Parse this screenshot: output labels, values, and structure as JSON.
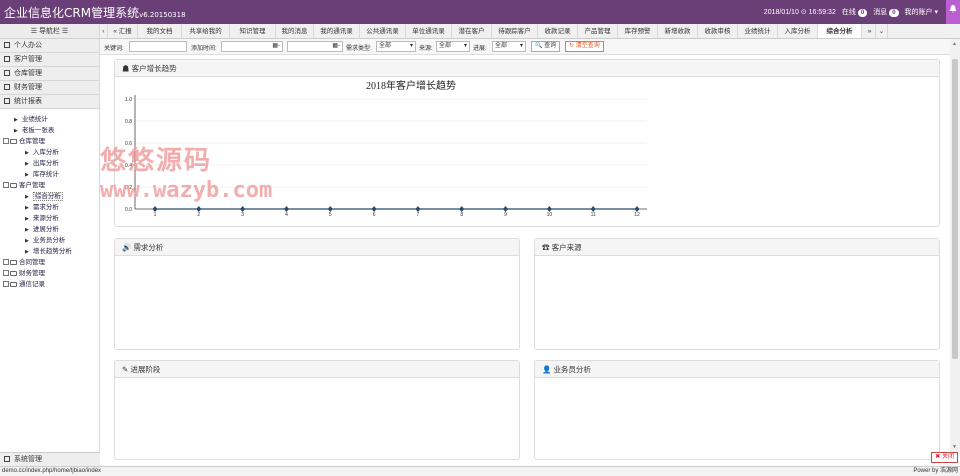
{
  "app": {
    "title": "企业信息化CRM管理系统",
    "version": "v6.20150318"
  },
  "header": {
    "datetime": "2018/01/10 ⊙ 16:59:32",
    "online_label": "在线",
    "online_count": "0",
    "msg_label": "消息",
    "msg_count": "0",
    "account": "我的账户 ▾"
  },
  "sidebar": {
    "nav_title": "☰ 导航栏 ☰",
    "menus": [
      "个人办公",
      "客户管理",
      "仓库管理",
      "财务管理",
      "统计报表"
    ],
    "system": "系统管理"
  },
  "tree": [
    {
      "label": "业绩统计",
      "level": 1,
      "type": "arrow"
    },
    {
      "label": "老板一张表",
      "level": 1,
      "type": "arrow"
    },
    {
      "label": "仓库管理",
      "level": 0,
      "type": "folder"
    },
    {
      "label": "入库分析",
      "level": 2,
      "type": "arrow"
    },
    {
      "label": "出库分析",
      "level": 2,
      "type": "arrow"
    },
    {
      "label": "库存统计",
      "level": 2,
      "type": "arrow"
    },
    {
      "label": "客户管理",
      "level": 0,
      "type": "folder"
    },
    {
      "label": "综合分析",
      "level": 2,
      "type": "arrow",
      "selected": true
    },
    {
      "label": "需求分析",
      "level": 2,
      "type": "arrow"
    },
    {
      "label": "来源分析",
      "level": 2,
      "type": "arrow"
    },
    {
      "label": "进展分析",
      "level": 2,
      "type": "arrow"
    },
    {
      "label": "业务员分析",
      "level": 2,
      "type": "arrow"
    },
    {
      "label": "增长趋势分析",
      "level": 2,
      "type": "arrow"
    },
    {
      "label": "合同管理",
      "level": 0,
      "type": "folder-closed"
    },
    {
      "label": "财务管理",
      "level": 0,
      "type": "folder-closed"
    },
    {
      "label": "通信记录",
      "level": 0,
      "type": "folder-closed"
    }
  ],
  "tabs": [
    "« 汇报",
    "我的文档",
    "共享给我的",
    "知识管理",
    "我的消息",
    "我的通讯录",
    "公共通讯录",
    "单位通讯录",
    "潜在客户",
    "待跟踪客户",
    "收款记录",
    "产品管理",
    "库存预警",
    "新增收款",
    "收款审核",
    "业绩统计",
    "入库分析",
    "综合分析"
  ],
  "tab_scroll": "»",
  "tab_menu": "⌄",
  "filter": {
    "keyword_label": "关键词:",
    "added_label": "添加时间:",
    "date_icon": "▦-",
    "demand_label": "需求类型:",
    "demand_value": "全部",
    "source_label": "来源:",
    "source_value": "全部",
    "progress_label": "进展:",
    "progress_value": "全部",
    "search_label": "🔍 查询",
    "clear_label": "↻ 清空查询"
  },
  "panels": {
    "growth": "客户增长趋势",
    "demand": "需求分析",
    "source": "客户来源",
    "progress": "进展阶段",
    "sales": "业务员分析"
  },
  "chart_data": {
    "type": "line",
    "title": "2018年客户增长趋势",
    "categories": [
      "1",
      "2",
      "3",
      "4",
      "5",
      "6",
      "7",
      "8",
      "9",
      "10",
      "11",
      "12"
    ],
    "series": [
      {
        "values": [
          0,
          0,
          0,
          0,
          0,
          0,
          0,
          0,
          0,
          0,
          0,
          0
        ]
      }
    ],
    "ylim": [
      0,
      1.0
    ],
    "yticks": [
      "0.0",
      "0.2",
      "0.4",
      "0.6",
      "0.8",
      "1.0"
    ],
    "grid": true,
    "colors": {
      "line": "#2a4a6a",
      "marker": "#2a4a6a"
    }
  },
  "watermark": {
    "cn": "悠悠源码",
    "url": "www.wazyb.com"
  },
  "status": {
    "url": "demo.cc/index.php/home/tjbiao/index",
    "powered": "Power by 浩源网"
  },
  "close_label": "✖ 关闭"
}
